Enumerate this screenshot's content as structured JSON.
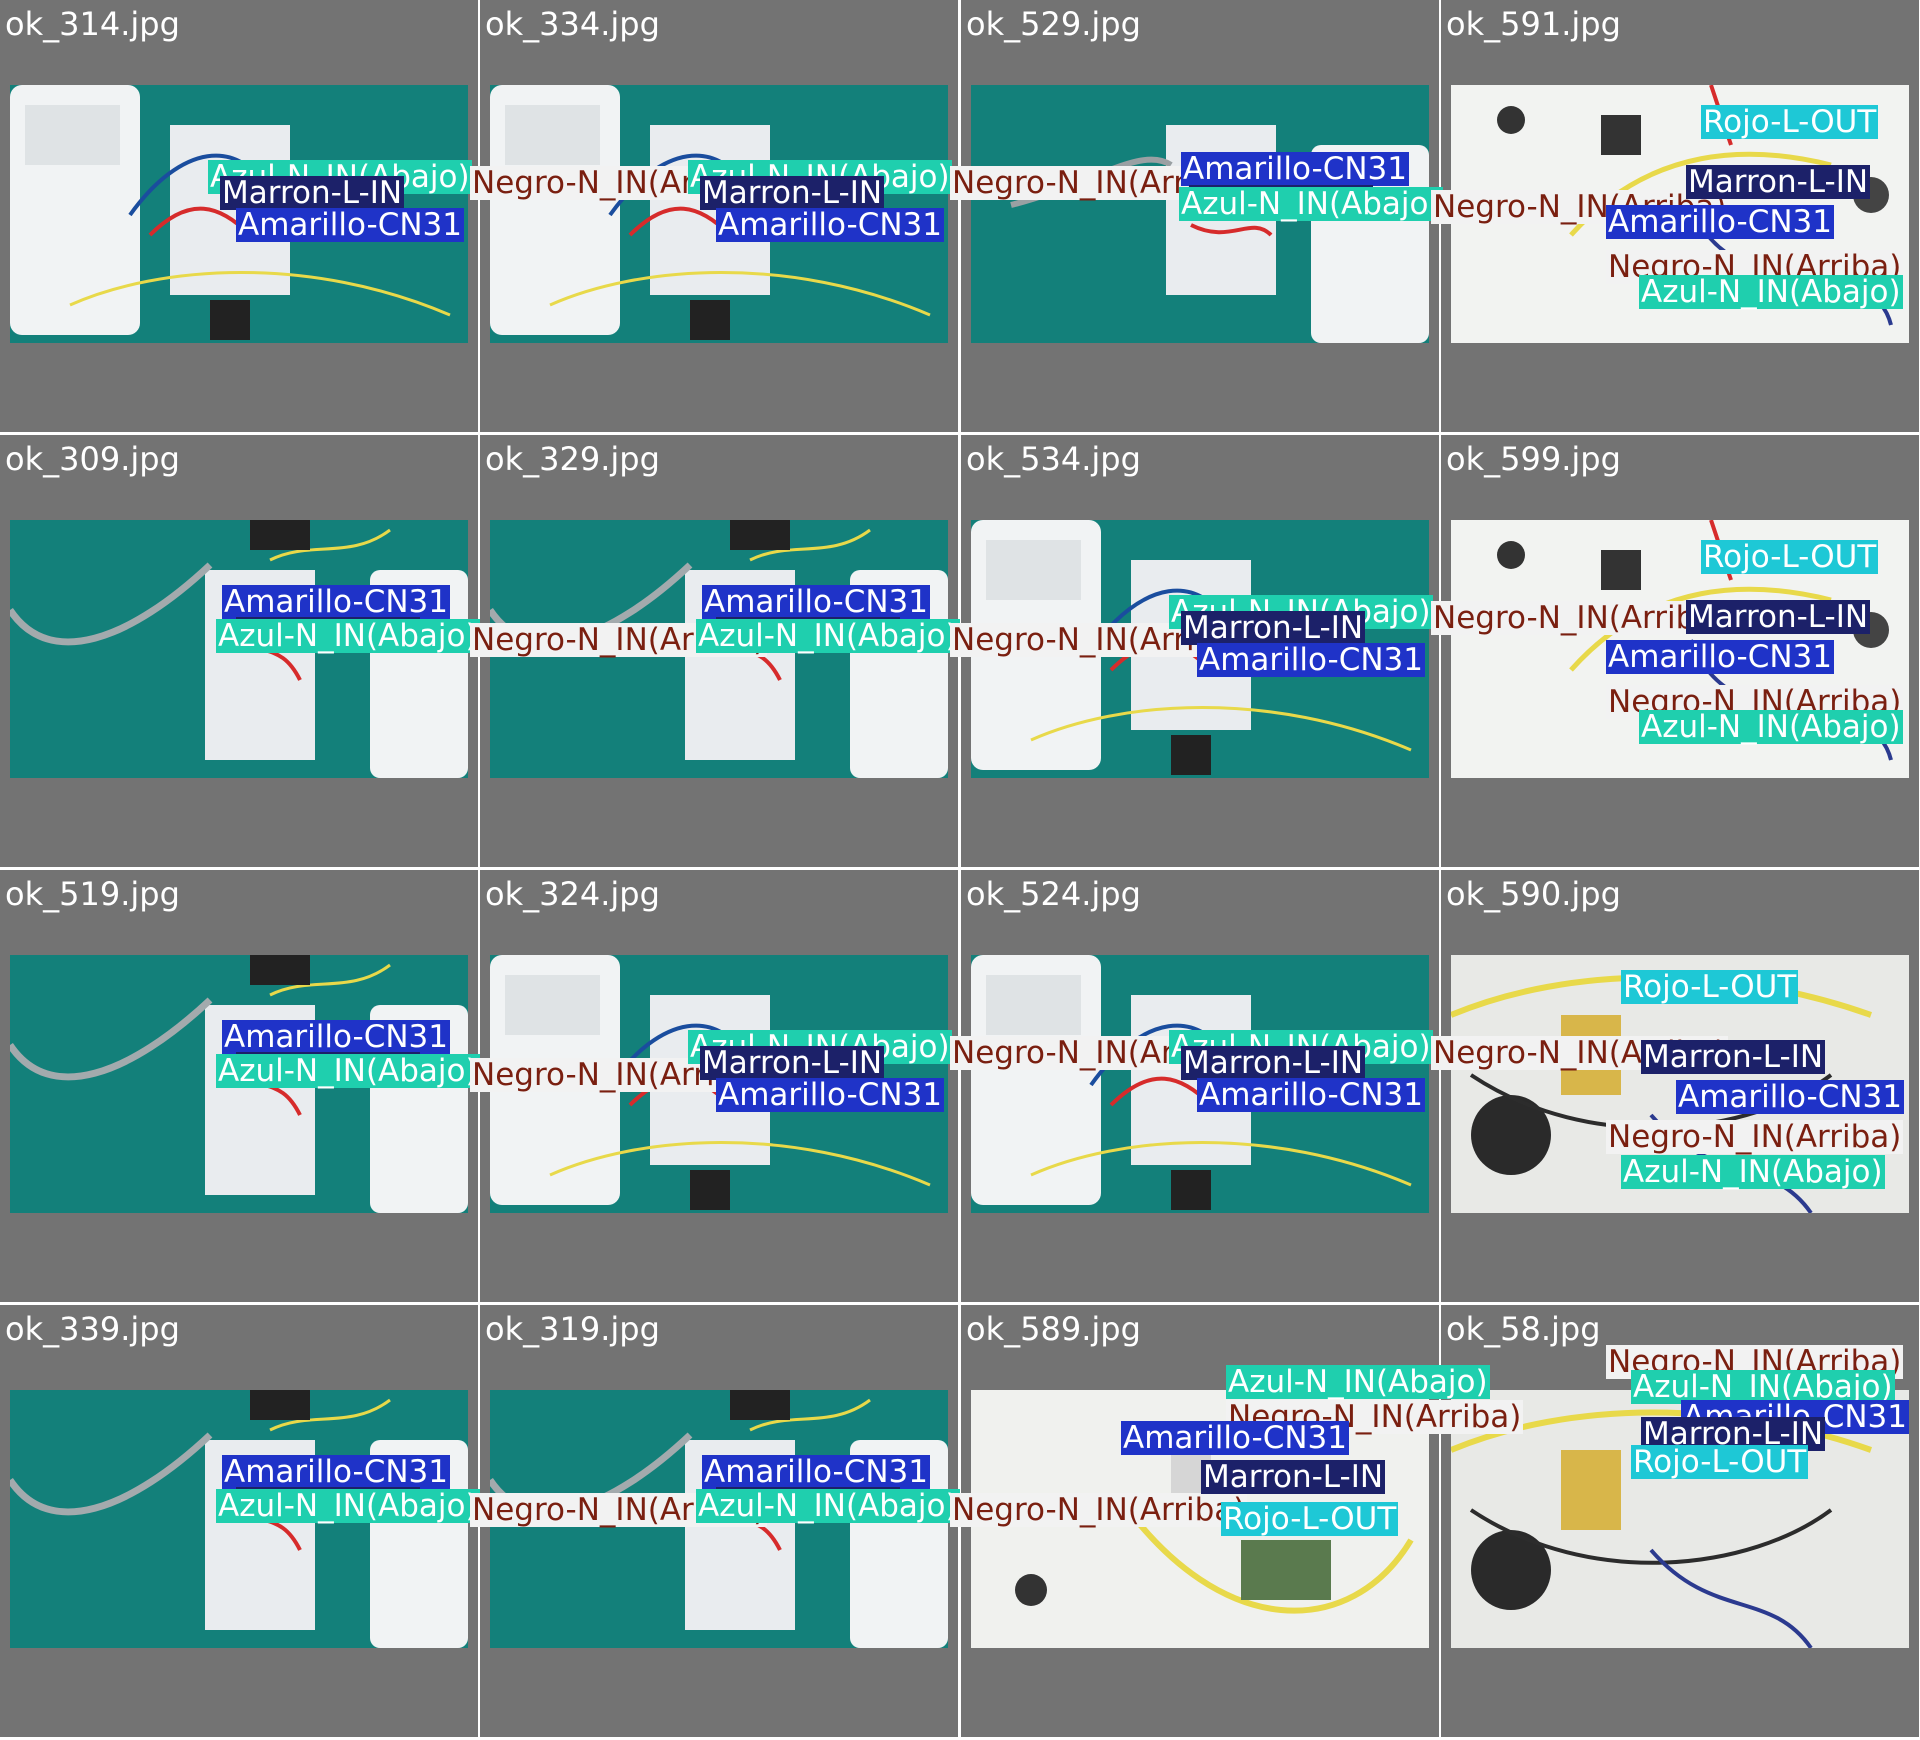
{
  "label_colors": {
    "Azul-N_IN(Abajo)": "#1fcfae",
    "Marron-L-IN": "#1c2169",
    "Amarillo-CN31": "#1f33c8",
    "Rojo-L-OUT": "#1ec8d6",
    "Negro-N_IN(Arriba)": "#f2f2f2"
  },
  "cells": [
    {
      "file": "ok_314.jpg",
      "scene": "board-white-box",
      "labels": [
        "Azul-N_IN(Abajo)",
        "Marron-L-IN",
        "Amarillo-CN31",
        "Negro-N_IN(Arriba)"
      ]
    },
    {
      "file": "ok_334.jpg",
      "scene": "board-white-box",
      "labels": [
        "Azul-N_IN(Abajo)",
        "Marron-L-IN",
        "Amarillo-CN31",
        "Negro-N_IN(Arriba)"
      ]
    },
    {
      "file": "ok_529.jpg",
      "scene": "board-right-box",
      "labels": [
        "Amarillo-CN31",
        "Marron-L-IN",
        "Azul-N_IN(Abajo)",
        "Negro-N_IN(Arriba)"
      ]
    },
    {
      "file": "ok_591.jpg",
      "scene": "large-board",
      "labels": [
        "Rojo-L-OUT",
        "Marron-L-IN",
        "Amarillo-CN31",
        "Negro-N_IN(Arriba)",
        "Azul-N_IN(Abajo)"
      ]
    },
    {
      "file": "ok_309.jpg",
      "scene": "board-right-box-tube",
      "labels": [
        "Amarillo-CN31",
        "Marron-L-IN",
        "Azul-N_IN(Abajo)",
        "Negro-N_IN(Arriba)"
      ]
    },
    {
      "file": "ok_329.jpg",
      "scene": "board-right-box-tube",
      "labels": [
        "Amarillo-CN31",
        "Marron-L-IN",
        "Azul-N_IN(Abajo)",
        "Negro-N_IN(Arriba)"
      ]
    },
    {
      "file": "ok_534.jpg",
      "scene": "board-white-box",
      "labels": [
        "Azul-N_IN(Abajo)",
        "Marron-L-IN",
        "Amarillo-CN31",
        "Negro-N_IN(Arriba)"
      ]
    },
    {
      "file": "ok_599.jpg",
      "scene": "large-board",
      "labels": [
        "Rojo-L-OUT",
        "Marron-L-IN",
        "Amarillo-CN31",
        "Negro-N_IN(Arriba)",
        "Azul-N_IN(Abajo)"
      ]
    },
    {
      "file": "ok_519.jpg",
      "scene": "board-right-box-tube",
      "labels": [
        "Amarillo-CN31",
        "Marron-L-IN",
        "Azul-N_IN(Abajo)",
        "Negro-N_IN(Arriba)"
      ]
    },
    {
      "file": "ok_324.jpg",
      "scene": "board-white-box",
      "labels": [
        "Azul-N_IN(Abajo)",
        "Marron-L-IN",
        "Amarillo-CN31",
        "Negro-N_IN(Arriba)"
      ]
    },
    {
      "file": "ok_524.jpg",
      "scene": "board-white-box",
      "labels": [
        "Azul-N_IN(Abajo)",
        "Marron-L-IN",
        "Amarillo-CN31",
        "Negro-N_IN(Arriba)"
      ]
    },
    {
      "file": "ok_590.jpg",
      "scene": "large-board-dark",
      "labels": [
        "Rojo-L-OUT",
        "Marron-L-IN",
        "Amarillo-CN31",
        "Negro-N_IN(Arriba)",
        "Azul-N_IN(Abajo)"
      ]
    },
    {
      "file": "ok_339.jpg",
      "scene": "board-right-box-tube",
      "labels": [
        "Amarillo-CN31",
        "Marron-L-IN",
        "Azul-N_IN(Abajo)",
        "Negro-N_IN(Arriba)"
      ]
    },
    {
      "file": "ok_319.jpg",
      "scene": "board-right-box-tube",
      "labels": [
        "Amarillo-CN31",
        "Marron-L-IN",
        "Azul-N_IN(Abajo)",
        "Negro-N_IN(Arriba)"
      ]
    },
    {
      "file": "ok_589.jpg",
      "scene": "large-board-rotated",
      "labels": [
        "Azul-N_IN(Abajo)",
        "Negro-N_IN(Arriba)",
        "Amarillo-CN31",
        "Marron-L-IN",
        "Rojo-L-OUT"
      ]
    },
    {
      "file": "ok_58.jpg",
      "scene": "large-board-dark",
      "labels": [
        "Negro-N_IN(Arriba)",
        "Azul-N_IN(Abajo)",
        "Amarillo-CN31",
        "Marron-L-IN",
        "Rojo-L-OUT"
      ]
    }
  ]
}
